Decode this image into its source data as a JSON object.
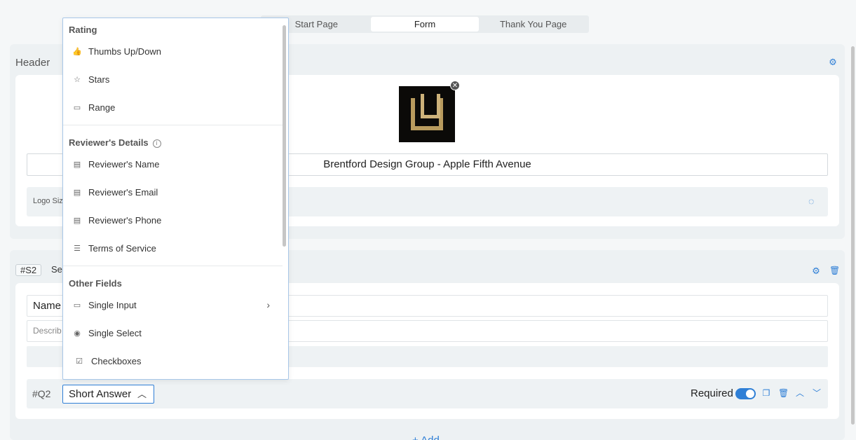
{
  "tabs": [
    {
      "label": "Start Page",
      "active": false
    },
    {
      "label": "Form",
      "active": true
    },
    {
      "label": "Thank You Page",
      "active": false
    }
  ],
  "header_section": {
    "title": "Header",
    "form_title": "Brentford Design Group - Apple Fifth Avenue",
    "logo_row_label": "Logo Siz"
  },
  "section_two": {
    "badge": "#S2",
    "name_partial": "Se",
    "name_field": "Name",
    "description_field": "Describ",
    "question": {
      "id": "#Q2",
      "type": "Short Answer",
      "required_label": "Required",
      "required": true
    },
    "add_label": "+ Add"
  },
  "dropdown": {
    "groups": [
      {
        "title": "Rating",
        "items": [
          {
            "label": "Thumbs Up/Down",
            "icon": "thumbs-icon"
          },
          {
            "label": "Stars",
            "icon": "star-icon"
          },
          {
            "label": "Range",
            "icon": "range-icon"
          }
        ]
      },
      {
        "title": "Reviewer's Details",
        "items": [
          {
            "label": "Reviewer's Name",
            "icon": "id-card-icon"
          },
          {
            "label": "Reviewer's Email",
            "icon": "email-card-icon"
          },
          {
            "label": "Reviewer's Phone",
            "icon": "phone-card-icon"
          },
          {
            "label": "Terms of Service",
            "icon": "document-icon"
          }
        ]
      },
      {
        "title": "Other Fields",
        "items": [
          {
            "label": "Single Input",
            "icon": "input-icon"
          },
          {
            "label": "Single Select",
            "icon": "radio-icon"
          },
          {
            "label": "Checkboxes",
            "icon": "checkbox-icon"
          }
        ]
      }
    ]
  },
  "colors": {
    "accent": "#2f7fd6",
    "background": "#f5f7f8"
  }
}
